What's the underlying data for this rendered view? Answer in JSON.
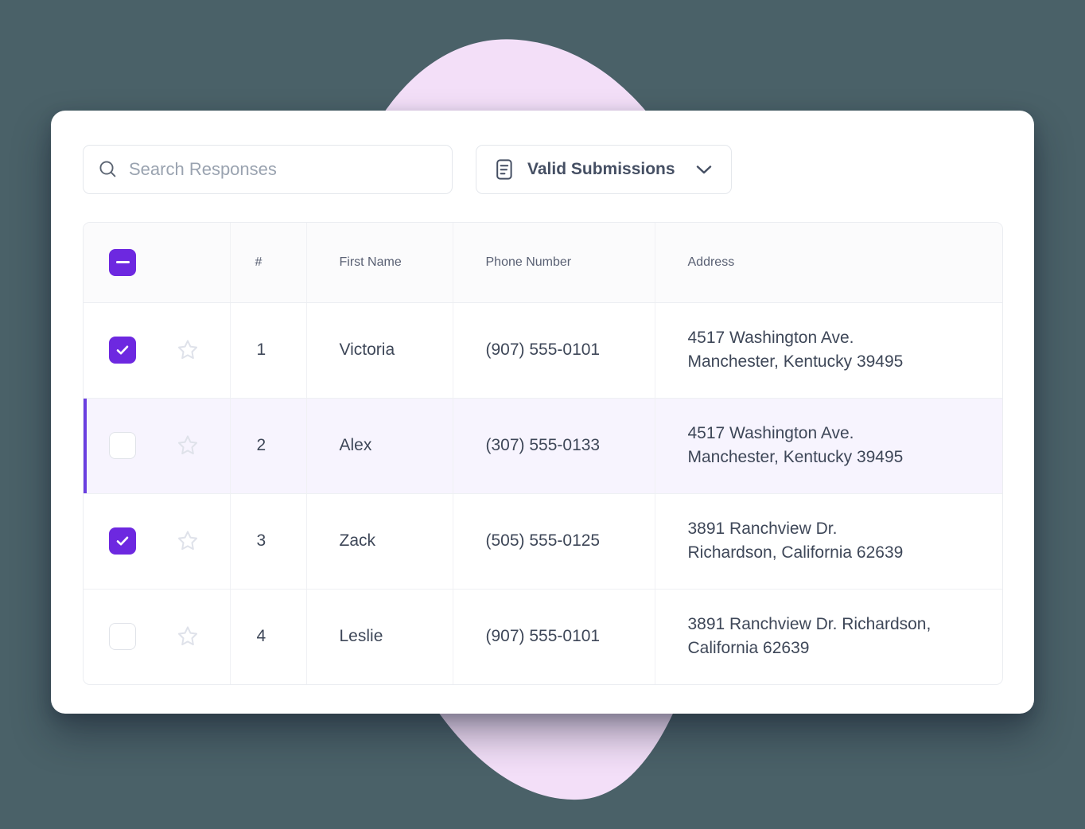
{
  "theme": {
    "page_background": "#4a6168",
    "blob_color": "#f3dff8",
    "card_background": "#ffffff",
    "accent_purple": "#6d28e0",
    "selected_row_background": "#f7f4fe",
    "header_background": "#fbfbfc",
    "border_color": "#ebedf1",
    "text_primary": "#3e4758",
    "text_header": "#596073",
    "placeholder_color": "#9aa3b0",
    "star_outline": "#dfe2ea"
  },
  "toolbar": {
    "search": {
      "icon": "search-icon",
      "value": "",
      "placeholder": "Search Responses"
    },
    "filter": {
      "icon": "document-lines-icon",
      "label": "Valid Submissions",
      "chevron_icon": "chevron-down-icon"
    }
  },
  "table": {
    "select_all_state": "indeterminate",
    "columns": [
      {
        "key": "check",
        "label": ""
      },
      {
        "key": "star",
        "label": ""
      },
      {
        "key": "num",
        "label": "#"
      },
      {
        "key": "name",
        "label": "First Name"
      },
      {
        "key": "phone",
        "label": "Phone Number"
      },
      {
        "key": "addr",
        "label": "Address"
      }
    ],
    "rows": [
      {
        "checked": true,
        "starred": false,
        "selected": false,
        "num": "1",
        "name": "Victoria",
        "phone": "(907) 555-0101",
        "address_line1": "4517 Washington Ave.",
        "address_line2": "Manchester, Kentucky 39495"
      },
      {
        "checked": false,
        "starred": false,
        "selected": true,
        "num": "2",
        "name": "Alex",
        "phone": "(307) 555-0133",
        "address_line1": "4517 Washington Ave.",
        "address_line2": "Manchester, Kentucky 39495"
      },
      {
        "checked": true,
        "starred": false,
        "selected": false,
        "num": "3",
        "name": "Zack",
        "phone": "(505) 555-0125",
        "address_line1": "3891 Ranchview Dr.",
        "address_line2": "Richardson, California 62639"
      },
      {
        "checked": false,
        "starred": false,
        "selected": false,
        "num": "4",
        "name": "Leslie",
        "phone": "(907) 555-0101",
        "address_line1": "3891 Ranchview Dr. Richardson,",
        "address_line2": "California 62639"
      }
    ]
  }
}
